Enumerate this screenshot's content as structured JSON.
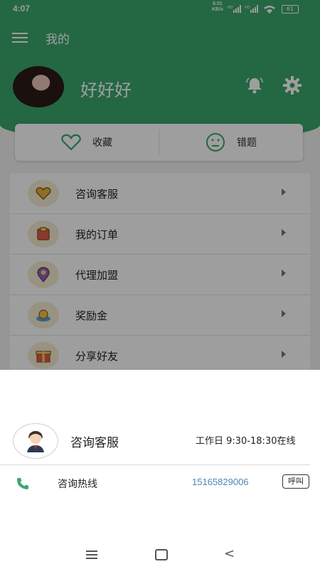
{
  "status_bar": {
    "time": "4:07",
    "speed": "6.01",
    "speed_unit": "KB/s",
    "network1": "HD",
    "network2": "HD",
    "battery": "61"
  },
  "header": {
    "title": "我的",
    "username": "好好好"
  },
  "quick_actions": [
    {
      "label": "收藏",
      "icon": "heart-icon"
    },
    {
      "label": "错题",
      "icon": "sad-face-icon"
    }
  ],
  "menu_items": [
    {
      "label": "咨询客服",
      "icon": "heart-badge-icon"
    },
    {
      "label": "我的订单",
      "icon": "order-bag-icon"
    },
    {
      "label": "代理加盟",
      "icon": "location-pin-icon"
    },
    {
      "label": "奖励金",
      "icon": "money-bag-icon"
    },
    {
      "label": "分享好友",
      "icon": "gift-icon"
    }
  ],
  "service_sheet": {
    "name": "咨询客服",
    "hours": "工作日 9:30-18:30在线",
    "hotline_label": "咨询热线",
    "hotline_number": "15165829006",
    "call_label": "呼叫"
  },
  "colors": {
    "primary": "#3aa76d",
    "link": "#4a86b8"
  }
}
